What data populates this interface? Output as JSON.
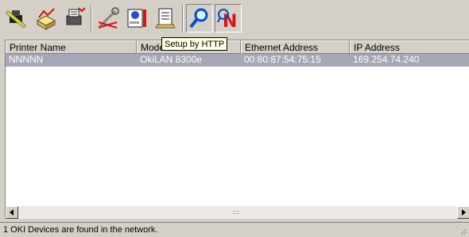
{
  "toolbar": {
    "tooltip": "Setup by HTTP",
    "buttons": [
      {
        "name": "printer-icon-button",
        "icon": "printer-wrench-icon",
        "pressed": false
      },
      {
        "name": "printer-red-button",
        "icon": "printer-alert-icon",
        "pressed": false
      },
      {
        "name": "printer-setup-button",
        "icon": "printer-settings-icon",
        "pressed": false
      },
      {
        "name": "tools-button",
        "icon": "wrench-icon",
        "pressed": false
      },
      {
        "name": "setup-http-button",
        "icon": "web-page-icon",
        "pressed": false
      },
      {
        "name": "notepad-button",
        "icon": "notepad-icon",
        "pressed": false
      },
      {
        "name": "search-button",
        "icon": "magnifier-icon",
        "pressed": true
      },
      {
        "name": "network-button",
        "icon": "n-logo-icon",
        "pressed": true
      }
    ]
  },
  "list": {
    "columns": [
      "Printer Name",
      "Mode",
      "Ethernet Address",
      "IP Address"
    ],
    "rows": [
      [
        "NNNNN",
        "OkiLAN 8300e",
        "00:80:87:54:75:15",
        "169.254.74.240"
      ]
    ]
  },
  "status": {
    "text": "1 OKI Devices are found in the network."
  }
}
